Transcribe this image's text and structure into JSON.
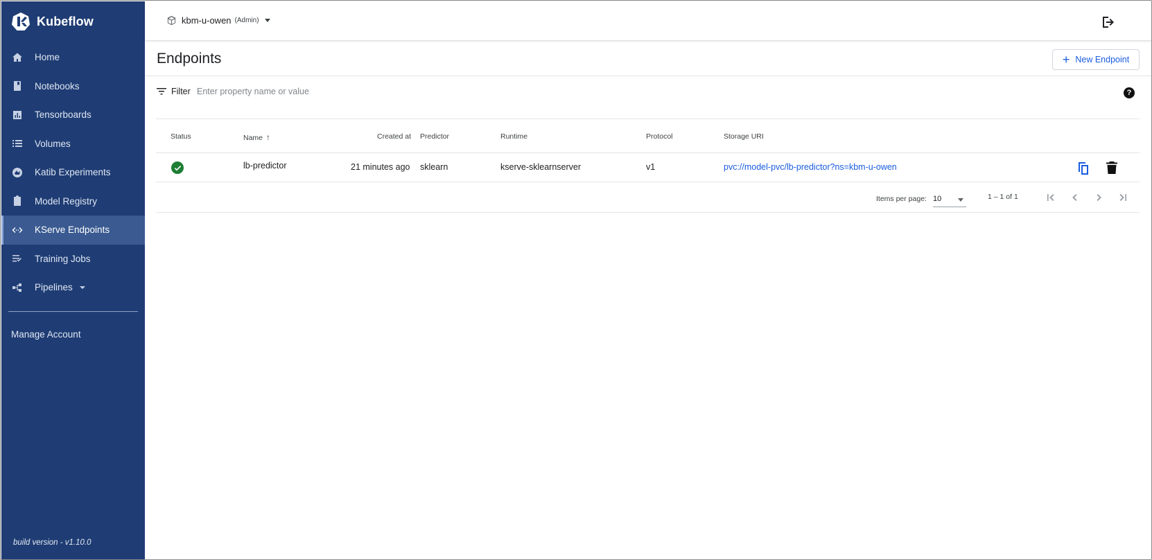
{
  "app": {
    "name": "Kubeflow",
    "build_version": "build version - v1.10.0"
  },
  "sidebar": {
    "items": [
      {
        "label": "Home",
        "icon": "home-icon"
      },
      {
        "label": "Notebooks",
        "icon": "book-icon"
      },
      {
        "label": "Tensorboards",
        "icon": "chart-icon"
      },
      {
        "label": "Volumes",
        "icon": "list-icon"
      },
      {
        "label": "Katib Experiments",
        "icon": "experiment-icon"
      },
      {
        "label": "Model Registry",
        "icon": "clipboard-icon"
      },
      {
        "label": "KServe Endpoints",
        "icon": "code-arrows-icon",
        "active": true
      },
      {
        "label": "Training Jobs",
        "icon": "checklist-icon"
      },
      {
        "label": "Pipelines",
        "icon": "pipeline-icon"
      }
    ],
    "manage_account": "Manage Account"
  },
  "topbar": {
    "namespace": "kbm-u-owen",
    "role": "(Admin)"
  },
  "page": {
    "title": "Endpoints",
    "new_button": "New Endpoint"
  },
  "filter": {
    "label": "Filter",
    "placeholder": "Enter property name or value"
  },
  "table": {
    "columns": [
      "Status",
      "Name",
      "Created at",
      "Predictor",
      "Runtime",
      "Protocol",
      "Storage URI"
    ],
    "rows": [
      {
        "status": "ready",
        "name": "lb-predictor",
        "created_at": "21 minutes ago",
        "predictor": "sklearn",
        "runtime": "kserve-sklearnserver",
        "protocol": "v1",
        "storage_uri": "pvc://model-pvc/lb-predictor?ns=kbm-u-owen"
      }
    ]
  },
  "pagination": {
    "items_per_page_label": "Items per page:",
    "items_per_page": "10",
    "range": "1 – 1 of 1"
  },
  "colors": {
    "sidebar": "#1f3d74",
    "sidebar_active": "#3a5a91",
    "accent": "#1a5ce0",
    "status_ok": "#1e7e34"
  }
}
